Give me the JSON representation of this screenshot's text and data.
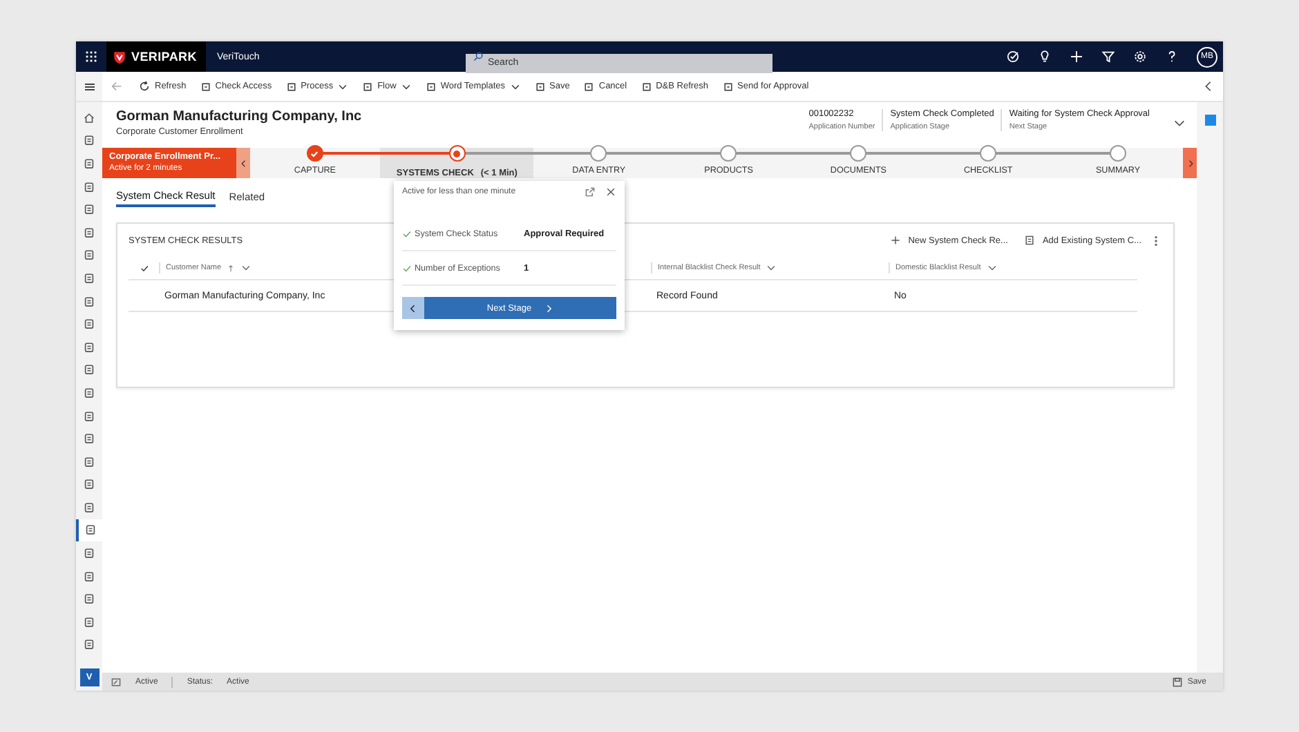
{
  "top_bar": {
    "brand": "VERIPARK",
    "app_name": "VeriTouch",
    "search": {
      "placeholder": "Search"
    },
    "avatar": "MB"
  },
  "command_bar": [
    {
      "label": "Refresh",
      "kind": "plain"
    },
    {
      "label": "Check Access",
      "kind": "plain"
    },
    {
      "label": "Process",
      "kind": "menu"
    },
    {
      "label": "Flow",
      "kind": "menu"
    },
    {
      "label": "Word Templates",
      "kind": "menu"
    },
    {
      "label": "Save",
      "kind": "plain"
    },
    {
      "label": "Cancel",
      "kind": "plain"
    },
    {
      "label": "D&B Refresh",
      "kind": "plain"
    },
    {
      "label": "Send for Approval",
      "kind": "plain"
    }
  ],
  "sidebar": {
    "items": [
      {
        "selected": false
      },
      {
        "selected": false
      },
      {
        "selected": false
      },
      {
        "selected": false
      },
      {
        "selected": false
      },
      {
        "selected": false
      },
      {
        "selected": false
      },
      {
        "selected": false
      },
      {
        "selected": false
      },
      {
        "selected": false
      },
      {
        "selected": false
      },
      {
        "selected": false
      },
      {
        "selected": false
      },
      {
        "selected": false
      },
      {
        "selected": false
      },
      {
        "selected": false
      },
      {
        "selected": false
      },
      {
        "selected": false
      },
      {
        "selected": true
      },
      {
        "selected": false
      },
      {
        "selected": false
      },
      {
        "selected": false
      },
      {
        "selected": false
      },
      {
        "selected": false
      }
    ],
    "bottom_badge": "V"
  },
  "header": {
    "title": "Gorman Manufacturing Company, Inc",
    "subtitle": "Corporate Customer Enrollment",
    "fields": [
      {
        "value": "001002232",
        "label": "Application Number"
      },
      {
        "value": "System Check Completed",
        "label": "Application Stage"
      },
      {
        "value": "Waiting for System Check Approval",
        "label": "Next Stage"
      }
    ]
  },
  "process": {
    "name": "Corporate Enrollment Pr...",
    "duration": "Active for 2 minutes",
    "stages": [
      {
        "label": "CAPTURE",
        "completed": true,
        "selected": false
      },
      {
        "label": "SYSTEMS CHECK",
        "time": "(< 1 Min)",
        "completed": false,
        "selected": true
      },
      {
        "label": "DATA ENTRY",
        "completed": false,
        "selected": false
      },
      {
        "label": "PRODUCTS",
        "completed": false,
        "selected": false
      },
      {
        "label": "DOCUMENTS",
        "completed": false,
        "selected": false
      },
      {
        "label": "CHECKLIST",
        "completed": false,
        "selected": false
      },
      {
        "label": "SUMMARY",
        "completed": false,
        "selected": false
      }
    ]
  },
  "flyout": {
    "title": "Active for less than one minute",
    "fields": [
      {
        "label": "System Check Status",
        "value": "Approval Required",
        "checked": true
      },
      {
        "label": "Number of Exceptions",
        "value": "1",
        "checked": true
      }
    ],
    "next_button": "Next Stage"
  },
  "tabs": [
    {
      "label": "System Check Result",
      "selected": true
    },
    {
      "label": "Related",
      "selected": false
    }
  ],
  "subgrid": {
    "title": "SYSTEM CHECK RESULTS",
    "actions": [
      "New System Check Re...",
      "Add Existing System C..."
    ],
    "columns": [
      "Customer Name",
      "Internal Blacklist Check Result",
      "Domestic Blacklist Result"
    ],
    "rows": [
      [
        "Gorman Manufacturing Company, Inc",
        "Record Found",
        "No"
      ]
    ]
  },
  "status_bar": {
    "state": "Active",
    "status_label": "Status:",
    "status_value": "Active",
    "save": "Save"
  }
}
